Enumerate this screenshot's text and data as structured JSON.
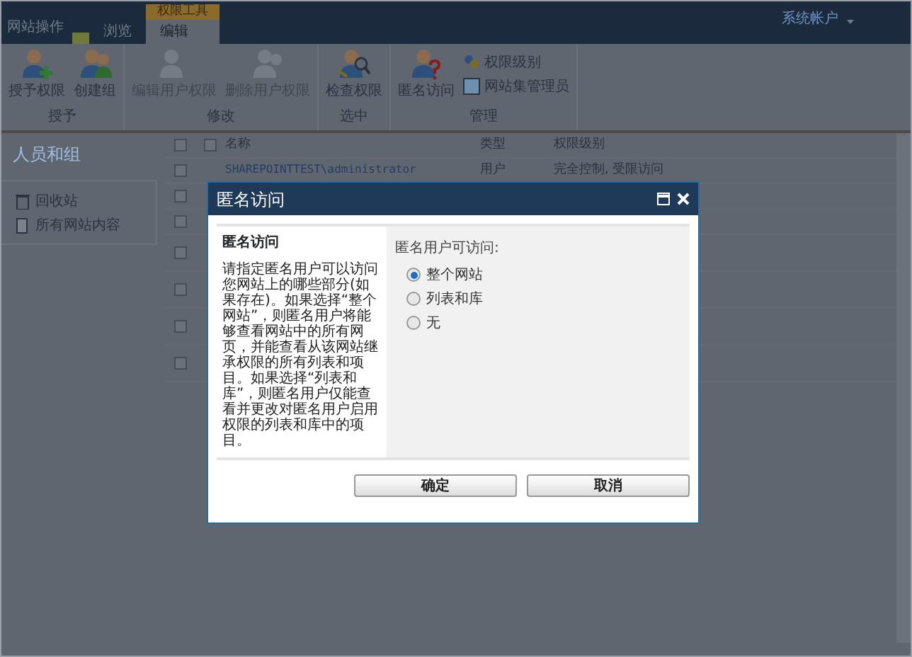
{
  "top_bar": {
    "site_actions": "网站操作",
    "context_group": "权限工具",
    "tabs": [
      {
        "label": "浏览",
        "selected": false
      },
      {
        "label": "编辑",
        "selected": true
      }
    ],
    "user": "系统帐户"
  },
  "ribbon": {
    "groups": [
      {
        "label": "授予",
        "buttons": [
          {
            "label": "授予权限",
            "kind": "large",
            "disabled": false
          },
          {
            "label": "创建组",
            "kind": "large",
            "disabled": false
          }
        ]
      },
      {
        "label": "修改",
        "buttons": [
          {
            "label": "编辑用户权限",
            "kind": "large",
            "disabled": true
          },
          {
            "label": "删除用户权限",
            "kind": "large",
            "disabled": true
          }
        ]
      },
      {
        "label": "选中",
        "buttons": [
          {
            "label": "检查权限",
            "kind": "large",
            "disabled": false
          }
        ]
      },
      {
        "label": "管理",
        "buttons": [
          {
            "label": "匿名访问",
            "kind": "large",
            "disabled": false
          },
          {
            "label": "权限级别",
            "kind": "small",
            "disabled": false
          },
          {
            "label": "网站集管理员",
            "kind": "small",
            "disabled": false
          }
        ]
      }
    ]
  },
  "left_nav": {
    "heading": "人员和组",
    "items": [
      {
        "label": "回收站"
      },
      {
        "label": "所有网站内容"
      }
    ]
  },
  "table": {
    "columns": [
      "名称",
      "类型",
      "权限级别"
    ],
    "header_checked": false,
    "name_header_checked": false,
    "rows": [
      {
        "checked": false,
        "name": "SHAREPOINTTEST\\administrator",
        "type": "用户",
        "permissions": "完全控制, 受限访问"
      },
      {
        "checked": false
      },
      {
        "checked": false
      },
      {
        "checked": false
      },
      {
        "checked": false
      },
      {
        "checked": false
      },
      {
        "checked": false
      }
    ]
  },
  "dialog": {
    "title": "匿名访问",
    "section_title": "匿名访问",
    "description": "请指定匿名用户可以访问您网站上的哪些部分(如果存在)。如果选择“整个网站”，则匿名用户将能够查看网站中的所有网页，并能查看从该网站继承权限的所有列表和项目。如果选择“列表和库”，则匿名用户仅能查看并更改对匿名用户启用权限的列表和库中的项目。",
    "field_label": "匿名用户可访问:",
    "options": [
      {
        "label": "整个网站",
        "selected": true
      },
      {
        "label": "列表和库",
        "selected": false
      },
      {
        "label": "无",
        "selected": false
      }
    ],
    "buttons": [
      "确定",
      "取消"
    ]
  }
}
